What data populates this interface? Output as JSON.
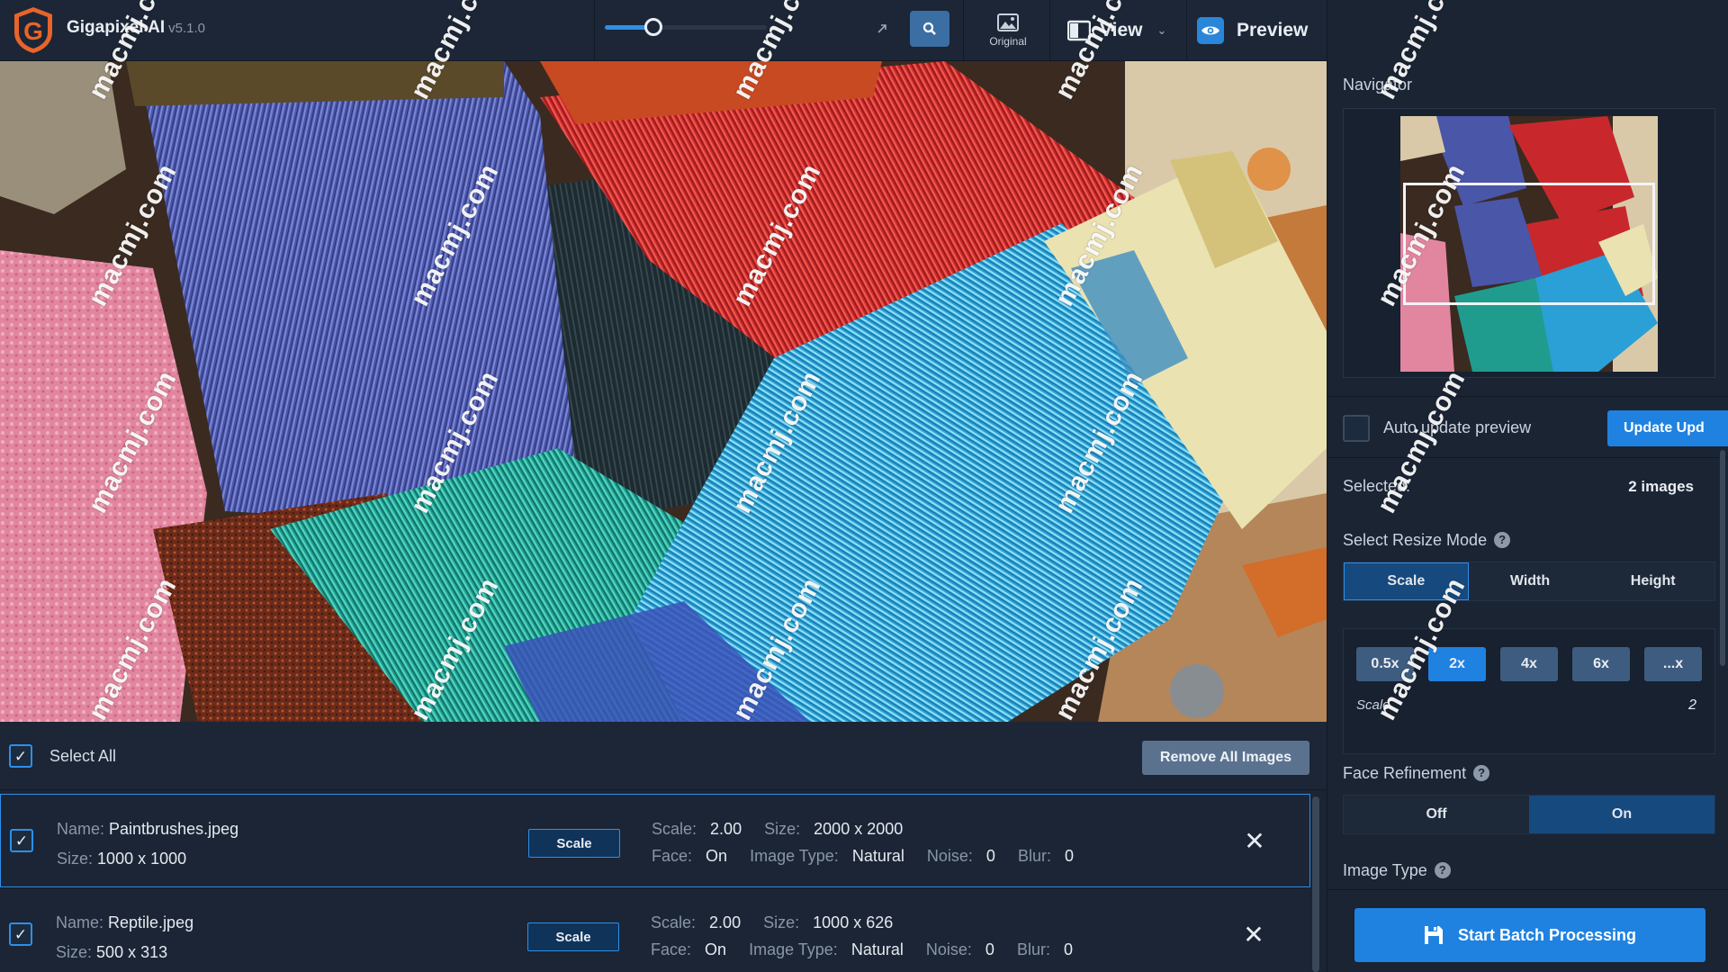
{
  "app": {
    "title": "Gigapixel AI",
    "version": "v5.1.0"
  },
  "toolbar": {
    "zoom_level": 0.3,
    "original_label": "Original",
    "view_label": "View",
    "preview_label": "Preview"
  },
  "list": {
    "select_all_label": "Select All",
    "remove_all_label": "Remove All Images",
    "files": [
      {
        "name_label": "Name:",
        "name": "Paintbrushes.jpeg",
        "size_label": "Size:",
        "size": "1000 x 1000",
        "badge": "Scale",
        "scale_label": "Scale:",
        "scale": "2.00",
        "out_size_label": "Size:",
        "out_size": "2000 x 2000",
        "face_label": "Face:",
        "face": "On",
        "type_label": "Image Type:",
        "type": "Natural",
        "noise_label": "Noise:",
        "noise": "0",
        "blur_label": "Blur:",
        "blur": "0"
      },
      {
        "name_label": "Name:",
        "name": "Reptile.jpeg",
        "size_label": "Size:",
        "size": "500 x 313",
        "badge": "Scale",
        "scale_label": "Scale:",
        "scale": "2.00",
        "out_size_label": "Size:",
        "out_size": "1000 x 626",
        "face_label": "Face:",
        "face": "On",
        "type_label": "Image Type:",
        "type": "Natural",
        "noise_label": "Noise:",
        "noise": "0",
        "blur_label": "Blur:",
        "blur": "0"
      }
    ]
  },
  "panel": {
    "navigator_label": "Navigator",
    "auto_update_label": "Auto update preview",
    "update_label": "Update   Upd",
    "selected_label": "Selected:",
    "selected_value": "2 images",
    "resize_mode_label": "Select Resize Mode",
    "resize_modes": [
      "Scale",
      "Width",
      "Height"
    ],
    "scale_options": [
      "0.5x",
      "2x",
      "4x",
      "6x",
      "...x"
    ],
    "scale_caption": "Scale",
    "scale_value": "2",
    "face_refinement_label": "Face Refinement",
    "face_options": [
      "Off",
      "On"
    ],
    "image_type_label": "Image Type",
    "batch_label": "Start Batch Processing"
  },
  "watermark": "macmj.com",
  "colors": {
    "accent": "#1f82e0",
    "panel": "#1a2433",
    "toolbar": "#1c2636"
  }
}
